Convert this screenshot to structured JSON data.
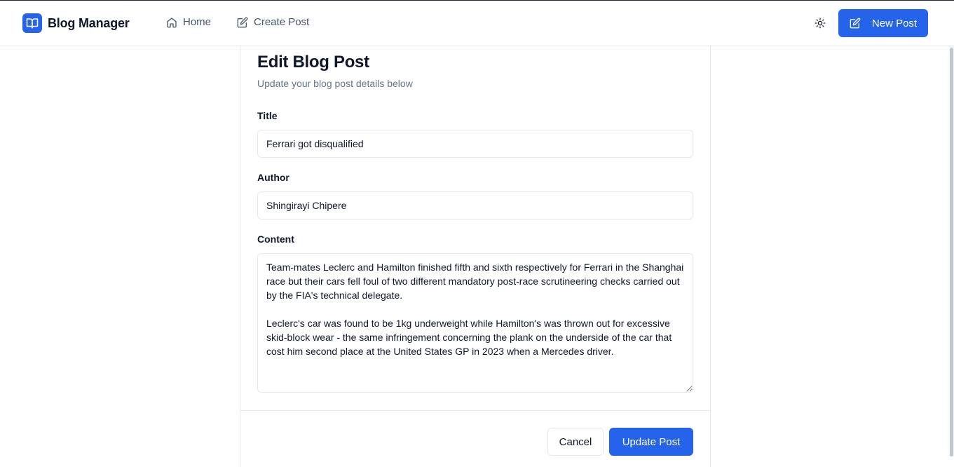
{
  "header": {
    "app_title": "Blog Manager",
    "logo_icon": "book-open-icon",
    "nav": [
      {
        "label": "Home",
        "icon": "home-icon"
      },
      {
        "label": "Create Post",
        "icon": "edit-icon"
      }
    ],
    "theme_toggle_icon": "sun-icon",
    "new_post_label": "New Post",
    "new_post_icon": "edit-icon"
  },
  "form": {
    "title": "Edit Blog Post",
    "subtitle": "Update your blog post details below",
    "fields": {
      "title_label": "Title",
      "title_value": "Ferrari got disqualified",
      "author_label": "Author",
      "author_value": "Shingirayi Chipere",
      "content_label": "Content",
      "content_value": "Team-mates Leclerc and Hamilton finished fifth and sixth respectively for Ferrari in the Shanghai race but their cars fell foul of two different mandatory post-race scrutineering checks carried out by the FIA's technical delegate.\n\nLeclerc's car was found to be 1kg underweight while Hamilton's was thrown out for excessive skid-block wear - the same infringement concerning the plank on the underside of the car that cost him second place at the United States GP in 2023 when a Mercedes driver."
    },
    "cancel_label": "Cancel",
    "submit_label": "Update Post"
  },
  "colors": {
    "primary": "#2563eb",
    "text": "#0f172a",
    "muted": "#64748b",
    "border": "#e2e8f0"
  }
}
